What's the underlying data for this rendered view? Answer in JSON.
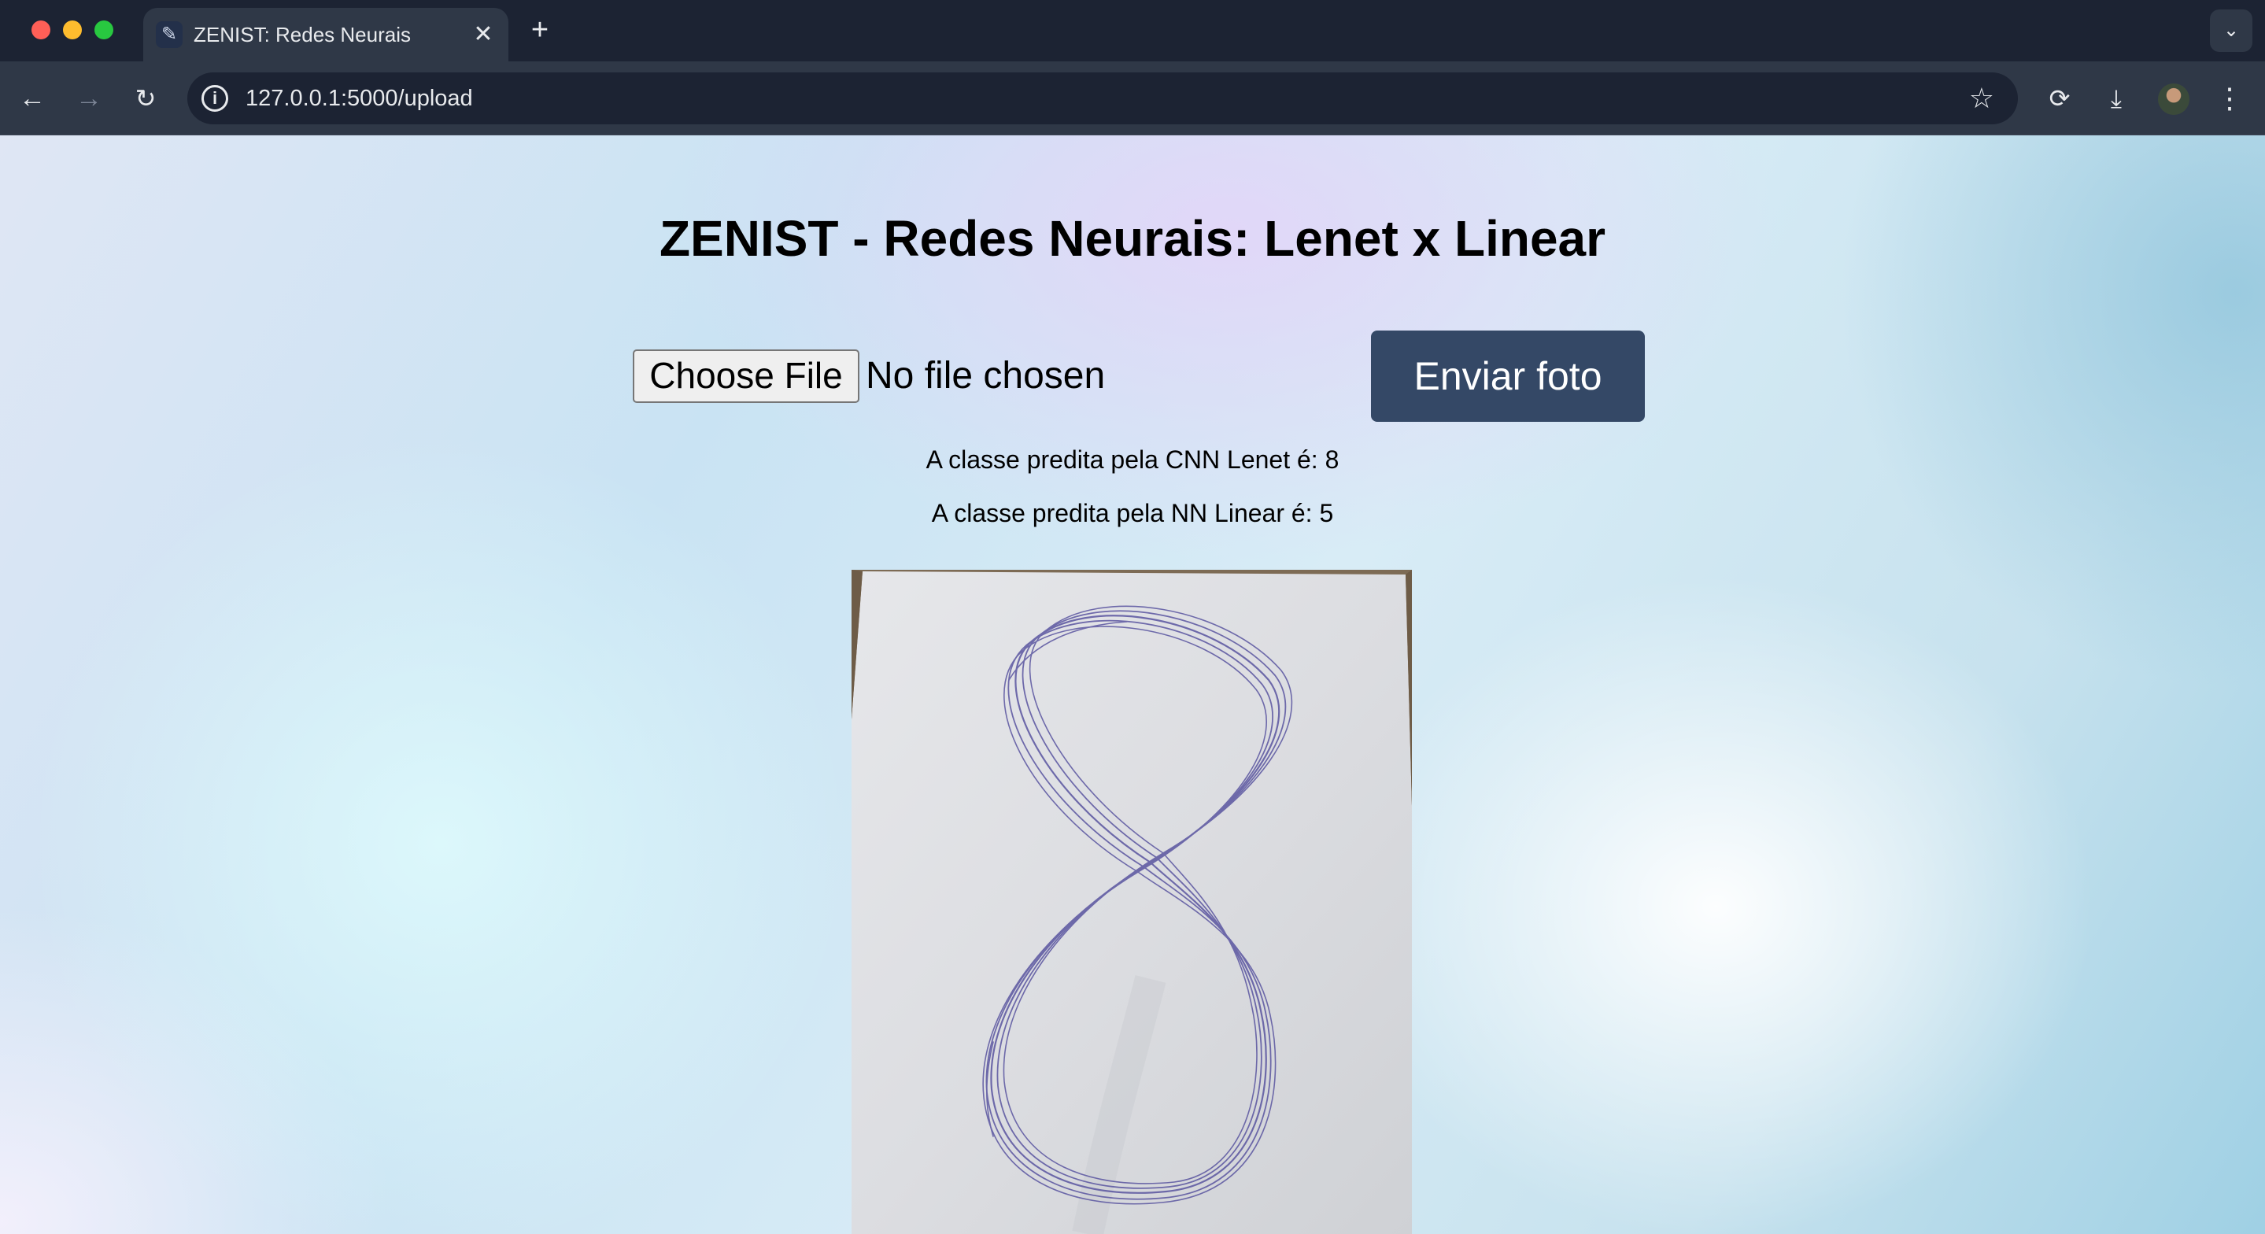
{
  "browser": {
    "tab_title": "ZENIST: Redes Neurais",
    "tab_close": "✕",
    "new_tab": "+",
    "url": "127.0.0.1:5000/upload",
    "icons": [
      "back-arrow-icon",
      "forward-arrow-icon",
      "reload-icon",
      "info-icon",
      "star-icon",
      "extension-icon",
      "download-icon",
      "profile-avatar",
      "more-menu-icon",
      "tab-search-icon"
    ]
  },
  "page": {
    "title": "ZENIST - Redes Neurais: Lenet x Linear",
    "file_input": {
      "button_label": "Choose File",
      "status": "No file chosen"
    },
    "submit_label": "Enviar foto",
    "results": {
      "cnn": "A classe predita pela CNN Lenet é: 8",
      "linear": "A classe predita pela NN Linear é: 5"
    },
    "image": {
      "description_icon": "handwritten-digit-photo"
    }
  },
  "colors": {
    "submit_button": "#344866",
    "chrome_dark": "#1c2333",
    "chrome_toolbar": "#2f3847",
    "ink": "#5a55a0"
  }
}
